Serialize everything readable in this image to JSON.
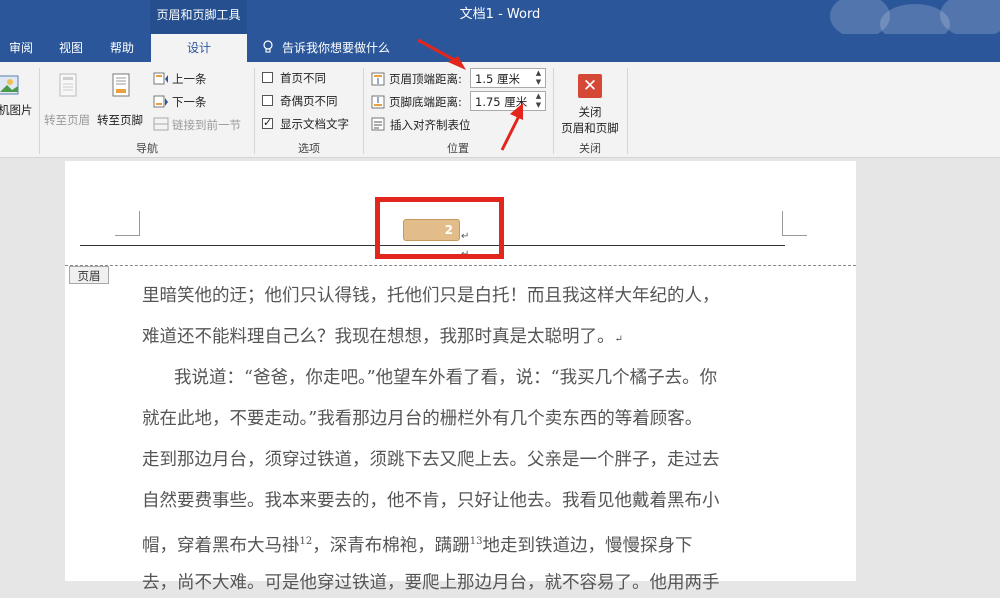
{
  "titlebar": {
    "context_label": "页眉和页脚工具",
    "title": "文档1  -  Word"
  },
  "tabs": [
    {
      "label": "审阅"
    },
    {
      "label": "视图"
    },
    {
      "label": "帮助"
    },
    {
      "label": "设计",
      "active": true
    }
  ],
  "tell_me": "告诉我你想要做什么",
  "ribbon": {
    "picture_label": "机图片",
    "nav": {
      "goto_header": "转至页眉",
      "goto_footer": "转至页脚",
      "prev": "上一条",
      "next": "下一条",
      "link_prev": "链接到前一节",
      "group": "导航"
    },
    "options": {
      "diff_first": "首页不同",
      "diff_odd_even": "奇偶页不同",
      "show_doc_text": "显示文档文字",
      "diff_first_checked": false,
      "diff_odd_even_checked": false,
      "show_doc_text_checked": true,
      "group": "选项"
    },
    "position": {
      "header_top_label": "页眉顶端距离:",
      "header_top_value": "1.5 厘米",
      "footer_bottom_label": "页脚底端距离:",
      "footer_bottom_value": "1.75 厘米",
      "insert_align_tab": "插入对齐制表位",
      "group": "位置"
    },
    "close": {
      "button_line1": "关闭",
      "button_line2": "页眉和页脚",
      "group": "关闭"
    }
  },
  "document": {
    "header_tag": "页眉",
    "page_number": "2",
    "lines": [
      "里暗笑他的迂；他们只认得钱，托他们只是白托！而且我这样大年纪的人，",
      "难道还不能料理自己么？我现在想想，我那时真是太聪明了。",
      "我说道：“爸爸，你走吧。”他望车外看了看，说：“我买几个橘子去。你",
      "就在此地，不要走动。”我看那边月台的栅栏外有几个卖东西的等着顾客。",
      "走到那边月台，须穿过铁道，须跳下去又爬上去。父亲是一个胖子，走过去",
      "自然要费事些。我本来要去的，他不肯，只好让他去。我看见他戴着黑布小",
      "帽，穿着黑布大马褂",
      "，深青布棉袍，蹒跚",
      "地走到铁道边，慢慢探身下",
      "去，尚不大难。可是他穿过铁道，要爬上那边月台，就不容易了。他用两手"
    ],
    "footnotes": [
      "12",
      "13"
    ]
  },
  "colors": {
    "ribbon_blue": "#2b579a",
    "annotation_red": "#e2261d",
    "pagenum_fill": "#e2bd8a"
  }
}
